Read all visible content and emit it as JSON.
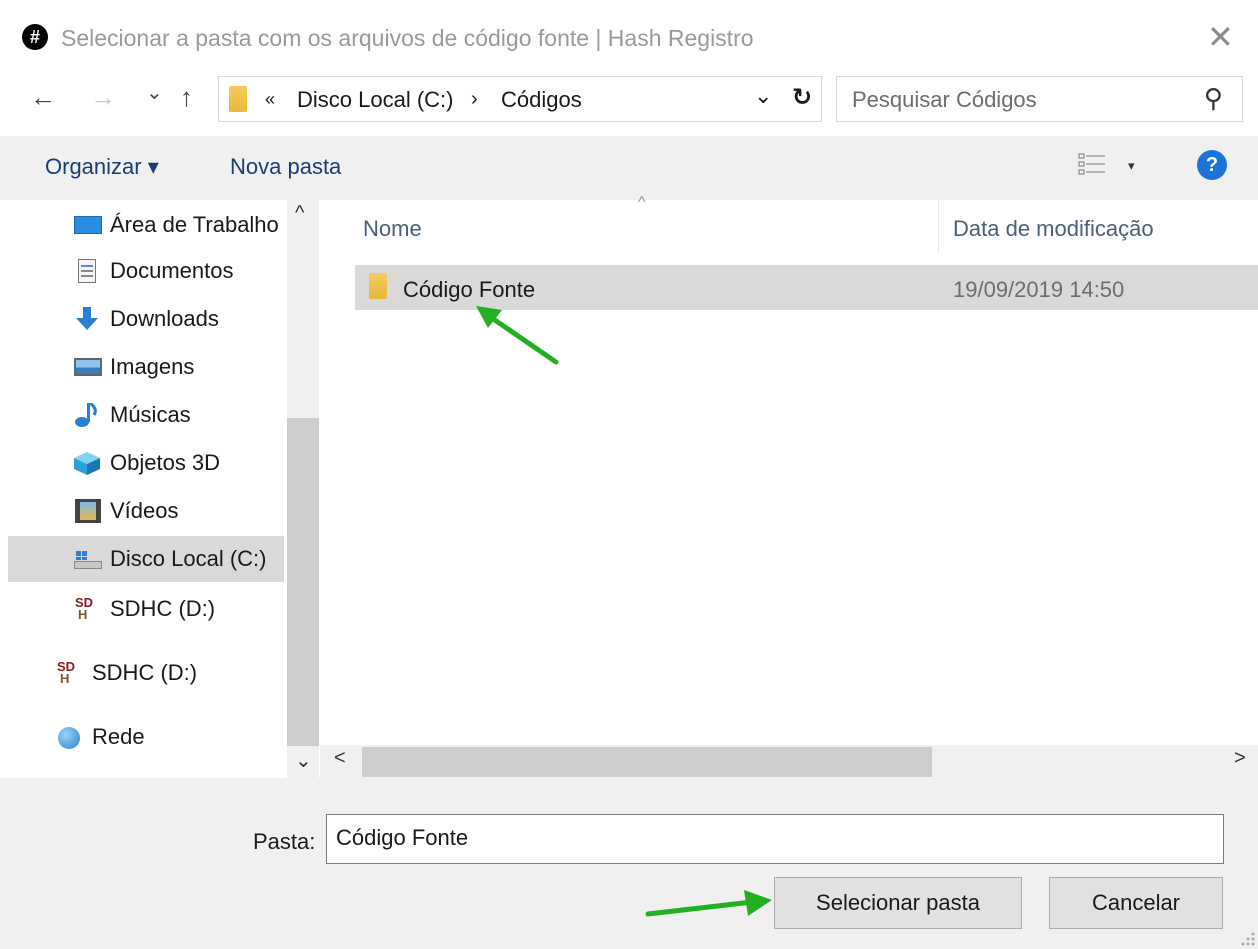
{
  "window": {
    "app_icon": "hash-icon",
    "app_icon_glyph": "#",
    "title": "Selecionar a pasta com os arquivos de código fonte | Hash Registro",
    "close_glyph": "✕"
  },
  "nav": {
    "back": "←",
    "forward": "→",
    "recent": "⌄",
    "up": "↑",
    "address": {
      "overflow": "«",
      "crumbs": [
        "Disco Local (C:)",
        "Códigos"
      ],
      "separator": "›",
      "dropdown": "⌄",
      "refresh": "↻"
    },
    "search_placeholder": "Pesquisar Códigos",
    "search_icon": "⚲"
  },
  "toolbar": {
    "organize": "Organizar ▾",
    "new_folder": "Nova pasta",
    "view_dropdown": "▾",
    "help": "?"
  },
  "sidebar": {
    "items": [
      {
        "label": "Área de Trabalho",
        "icon": "desktop-icon"
      },
      {
        "label": "Documentos",
        "icon": "documents-icon"
      },
      {
        "label": "Downloads",
        "icon": "download-icon"
      },
      {
        "label": "Imagens",
        "icon": "pictures-icon"
      },
      {
        "label": "Músicas",
        "icon": "music-icon"
      },
      {
        "label": "Objetos 3D",
        "icon": "objects-3d-icon"
      },
      {
        "label": "Vídeos",
        "icon": "videos-icon"
      },
      {
        "label": "Disco Local (C:)",
        "icon": "local-disk-icon",
        "selected": true
      },
      {
        "label": "SDHC (D:)",
        "icon": "sdhc-icon"
      },
      {
        "label": "SDHC (D:)",
        "icon": "sdhc-icon"
      },
      {
        "label": "Rede",
        "icon": "network-icon"
      }
    ],
    "scroll_up": "^",
    "scroll_down": "⌄"
  },
  "file_list": {
    "columns": [
      "Nome",
      "Data de modificação"
    ],
    "sort_glyph": "^",
    "rows": [
      {
        "name": "Código Fonte",
        "modified": "19/09/2019 14:50",
        "selected": true
      }
    ],
    "scroll_left": "<",
    "scroll_right": ">"
  },
  "footer": {
    "folder_label": "Pasta:",
    "folder_value": "Código Fonte",
    "select_button": "Selecionar pasta",
    "cancel_button": "Cancelar"
  },
  "colors": {
    "annotation_arrow": "#22b022",
    "selection": "#d9d9d9",
    "help_blue": "#1a73d9"
  }
}
